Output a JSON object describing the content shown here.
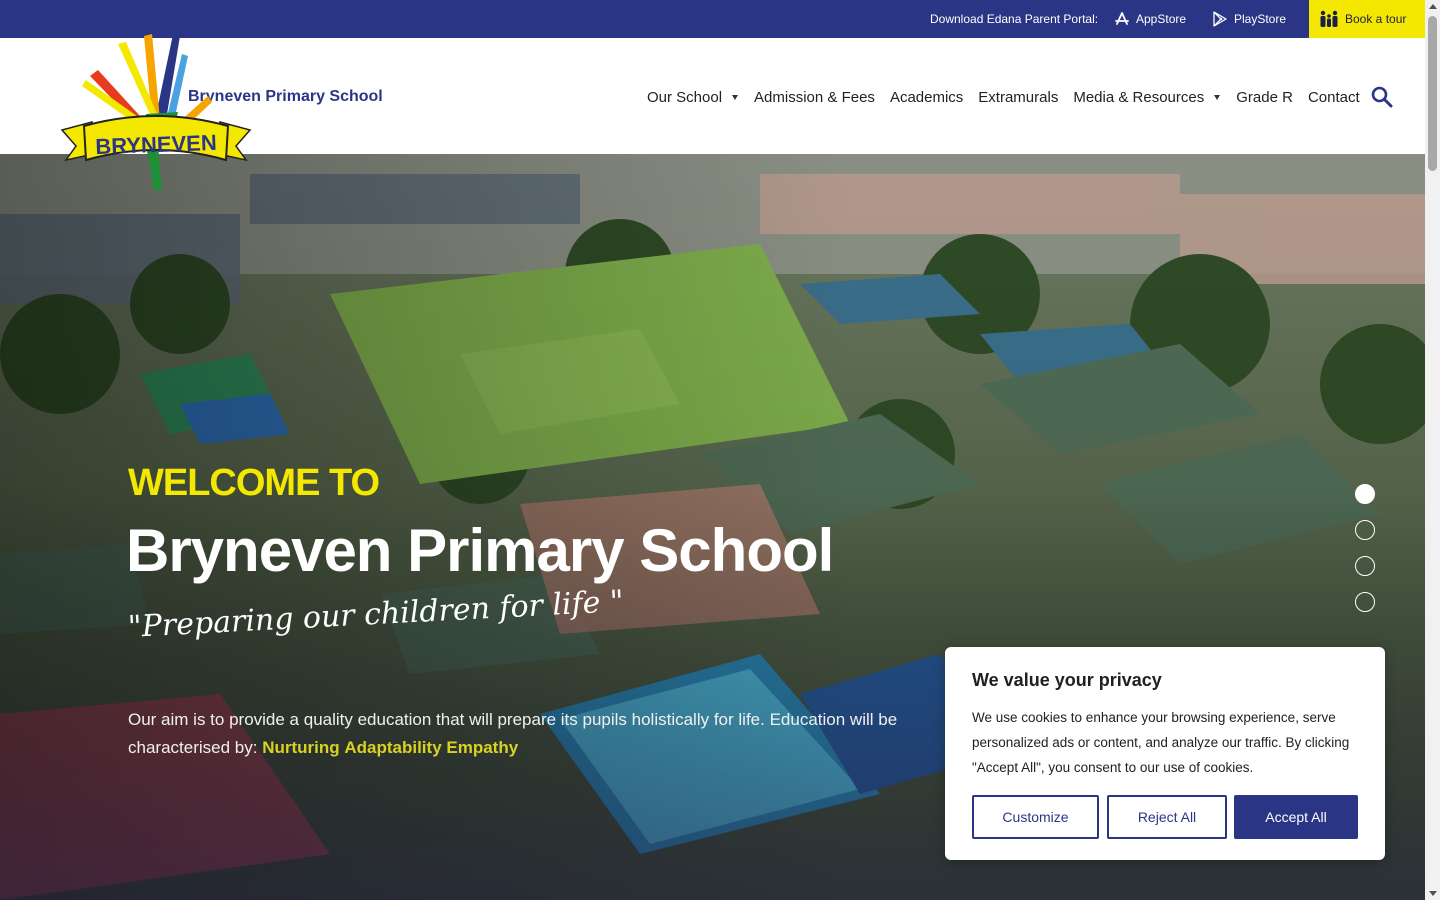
{
  "topbar": {
    "portal_label": "Download Edana Parent Portal:",
    "appstore_label": "AppStore",
    "playstore_label": "PlayStore",
    "tour_label": "Book a tour"
  },
  "header": {
    "brand_name": "Bryneven Primary School",
    "logo_text": "BRYNEVEN",
    "nav": [
      {
        "label": "Our School",
        "dropdown": true
      },
      {
        "label": "Admission & Fees",
        "dropdown": false
      },
      {
        "label": "Academics",
        "dropdown": false
      },
      {
        "label": "Extramurals",
        "dropdown": false
      },
      {
        "label": "Media & Resources",
        "dropdown": true
      },
      {
        "label": "Grade R",
        "dropdown": false
      },
      {
        "label": "Contact",
        "dropdown": false
      }
    ],
    "search_icon": "search-icon"
  },
  "hero": {
    "welcome": "WELCOME TO",
    "title": "Bryneven Primary School",
    "motto": "\"Preparing our children for life \"",
    "aim_text": "Our aim is to provide a quality education that will prepare its pupils holistically for life. Education will be characterised by:",
    "keywords": [
      "Nurturing",
      "Adaptability",
      "Empathy"
    ],
    "slides_total": 4,
    "slide_active": 1
  },
  "cookie": {
    "title": "We value your privacy",
    "body": "We use cookies to enhance your browsing experience, serve personalized ads or content, and analyze our traffic. By clicking \"Accept All\", you consent to our use of cookies.",
    "customize_label": "Customize",
    "reject_label": "Reject All",
    "accept_label": "Accept All"
  },
  "colors": {
    "brand_navy": "#2a3685",
    "brand_yellow": "#f5e800",
    "keyword_yellow": "#d9d223"
  }
}
